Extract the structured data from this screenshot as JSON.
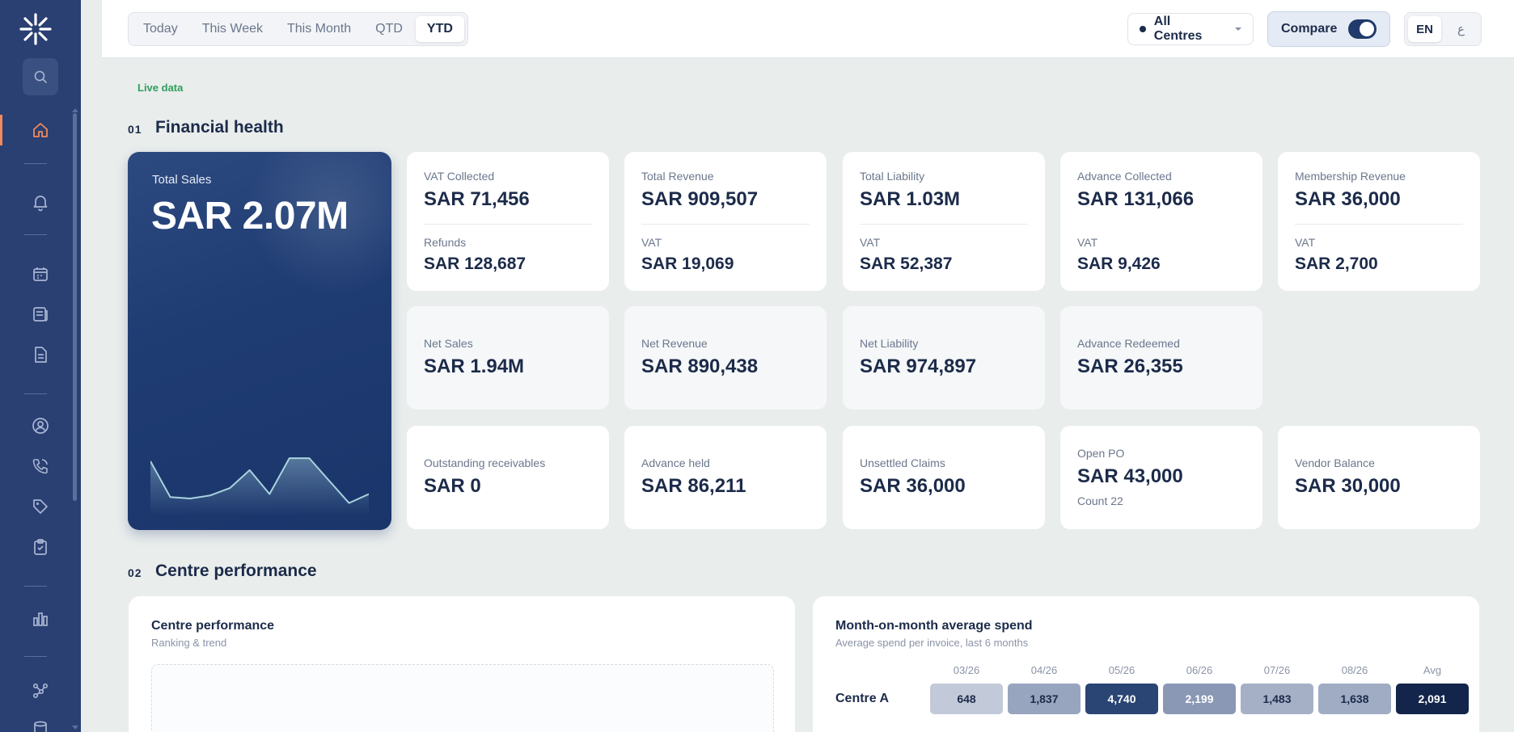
{
  "topbar": {
    "periods": [
      "Today",
      "This Week",
      "This Month",
      "QTD",
      "YTD"
    ],
    "active_period": "YTD",
    "centres_select": "All Centres",
    "compare_label": "Compare",
    "compare_on": true,
    "languages": [
      "EN",
      "ع"
    ],
    "active_language": "EN"
  },
  "status": {
    "live": "Live data"
  },
  "sections": {
    "financial": {
      "num": "01",
      "title": "Financial health"
    },
    "centre": {
      "num": "02",
      "title": "Centre performance"
    }
  },
  "hero": {
    "label": "Total Sales",
    "value": "SAR 2.07M",
    "trend": [
      62,
      38,
      37,
      39,
      44,
      56,
      40,
      64,
      64,
      49,
      34,
      40
    ]
  },
  "cards_row1": [
    {
      "label": "VAT Collected",
      "value": "SAR 71,456",
      "sub_label": "Refunds",
      "sub_value": "SAR 128,687"
    },
    {
      "label": "Total Revenue",
      "value": "SAR 909,507",
      "sub_label": "VAT",
      "sub_value": "SAR 19,069"
    },
    {
      "label": "Total Liability",
      "value": "SAR 1.03M",
      "sub_label": "VAT",
      "sub_value": "SAR 52,387"
    },
    {
      "label": "Advance Collected",
      "value": "SAR 131,066",
      "sub_label": "VAT",
      "sub_value": "SAR 9,426"
    },
    {
      "label": "Membership Revenue",
      "value": "SAR 36,000",
      "sub_label": "VAT",
      "sub_value": "SAR 2,700"
    }
  ],
  "cards_row2": [
    {
      "label": "Net Sales",
      "value": "SAR 1.94M"
    },
    {
      "label": "Net Revenue",
      "value": "SAR 890,438"
    },
    {
      "label": "Net Liability",
      "value": "SAR 974,897"
    },
    {
      "label": "Advance Redeemed",
      "value": "SAR 26,355"
    }
  ],
  "cards_row3": [
    {
      "label": "Outstanding receivables",
      "value": "SAR 0"
    },
    {
      "label": "Advance held",
      "value": "SAR 86,211"
    },
    {
      "label": "Unsettled Claims",
      "value": "SAR 36,000"
    },
    {
      "label": "Open PO",
      "value": "SAR 43,000",
      "note": "Count 22"
    },
    {
      "label": "Vendor Balance",
      "value": "SAR 30,000"
    }
  ],
  "centre_panel": {
    "title": "Centre performance",
    "subtitle": "Ranking & trend"
  },
  "spend_panel": {
    "title": "Month-on-month average spend",
    "subtitle": "Average spend per invoice, last 6 months",
    "columns": [
      "03/26",
      "04/26",
      "05/26",
      "06/26",
      "07/26",
      "08/26",
      "Avg"
    ],
    "rows": [
      {
        "name": "Centre A",
        "values": [
          "648",
          "1,837",
          "4,740",
          "2,199",
          "1,483",
          "1,638",
          "2,091"
        ]
      }
    ]
  },
  "colors": {
    "sidebar": "#2a3f72",
    "accent": "#f08a5d",
    "live": "#2f9e5b",
    "navy": "#1a356a"
  }
}
